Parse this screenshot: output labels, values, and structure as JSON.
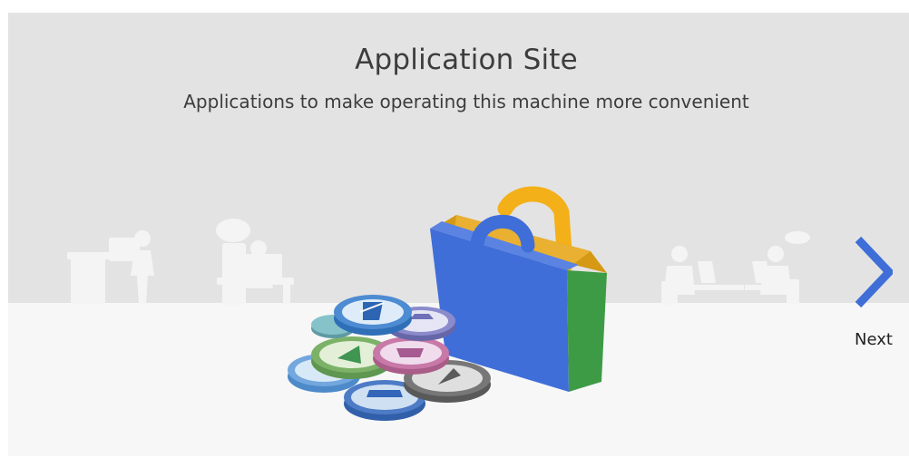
{
  "page": {
    "title": "Application Site",
    "subtitle": "Applications to make operating this machine more convenient"
  },
  "navigation": {
    "next_label": "Next",
    "next_icon": "chevron-right-icon"
  },
  "colors": {
    "upper_background": "#e3e3e3",
    "lower_background": "#f7f7f7",
    "accent_blue": "#3f6ed8",
    "bag_green": "#3e9b45",
    "bag_yellow": "#f3b018",
    "silhouette": "#f4f4f4"
  },
  "illustration": {
    "name": "shopping-bag-with-app-coins",
    "background_scenes": [
      "copier-user",
      "desk-worker",
      "meeting-left",
      "meeting-right"
    ]
  }
}
